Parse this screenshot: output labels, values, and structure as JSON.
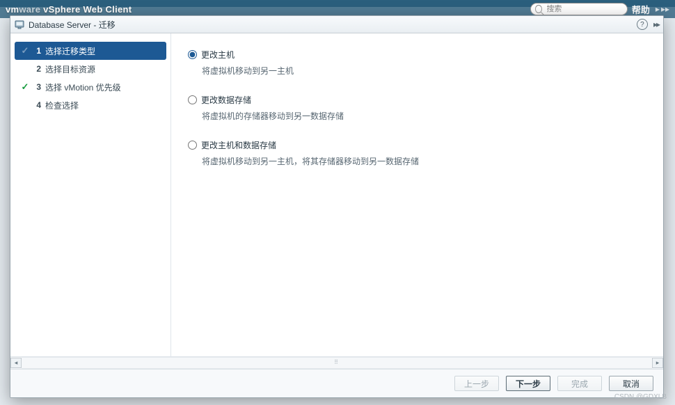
{
  "background": {
    "product_title": "vSphere Web Client",
    "search_placeholder": "搜索",
    "help_label": "帮助"
  },
  "dialog": {
    "title": "Database Server - 迁移"
  },
  "wizard": {
    "steps": [
      {
        "num": "1",
        "label": "选择迁移类型",
        "active": true,
        "checked": true
      },
      {
        "num": "2",
        "label": "选择目标资源",
        "active": false,
        "checked": false
      },
      {
        "num": "3",
        "label": "选择 vMotion 优先级",
        "active": false,
        "checked": true
      },
      {
        "num": "4",
        "label": "检查选择",
        "active": false,
        "checked": false
      }
    ]
  },
  "options": [
    {
      "id": "opt-host",
      "label": "更改主机",
      "desc": "将虚拟机移动到另一主机",
      "selected": true
    },
    {
      "id": "opt-ds",
      "label": "更改数据存储",
      "desc": "将虚拟机的存储器移动到另一数据存储",
      "selected": false
    },
    {
      "id": "opt-host-ds",
      "label": "更改主机和数据存储",
      "desc": "将虚拟机移动到另一主机，将其存储器移动到另一数据存储",
      "selected": false
    }
  ],
  "footer": {
    "back": "上一步",
    "next": "下一步",
    "finish": "完成",
    "cancel": "取消"
  },
  "watermark": "CSDN @GDXLB"
}
